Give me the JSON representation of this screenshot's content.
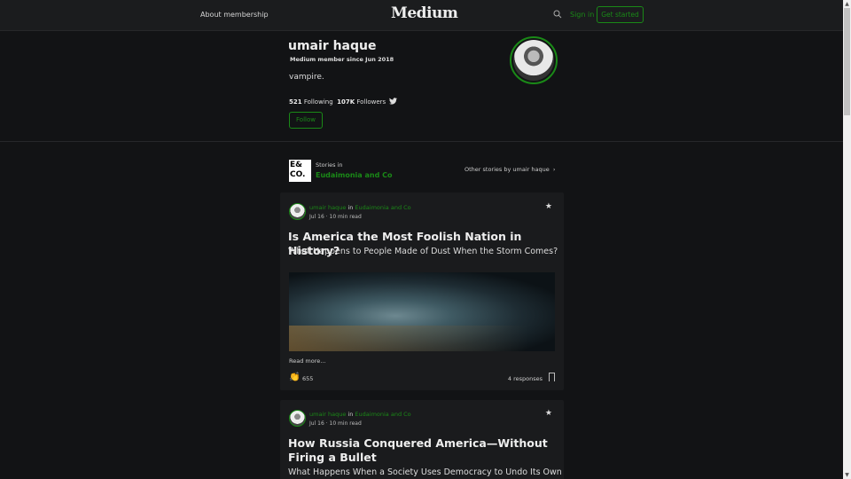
{
  "header": {
    "about": "About membership",
    "logo": "Medium",
    "sign_in": "Sign in",
    "get_started": "Get started"
  },
  "profile": {
    "name": "umair haque",
    "since": "Medium member since Jun 2018",
    "bio": "vampire.",
    "following_count": "521",
    "following_label": "Following",
    "followers_count": "107K",
    "followers_label": "Followers",
    "separator": "·",
    "follow": "Follow"
  },
  "publication": {
    "logo_text": "E& CO.",
    "stories_in": "Stories in",
    "name": "Eudaimonia and Co",
    "other": "Other stories by umair haque"
  },
  "posts": [
    {
      "author": "umair haque",
      "in": "in",
      "pub": "Eudaimonia and Co",
      "date": "Jul 16",
      "read": "10 min read",
      "title": "Is America the Most Foolish Nation in History?",
      "subtitle": "What Happens to People Made of Dust When the Storm Comes?",
      "read_more": "Read more…",
      "claps": "655",
      "responses": "4 responses"
    },
    {
      "author": "umair haque",
      "in": "in",
      "pub": "Eudaimonia and Co",
      "date": "Jul 16",
      "read": "10 min read",
      "title": "How Russia Conquered America—Without Firing a Bullet",
      "subtitle": "What Happens When a Society Uses Democracy to Undo Its Own"
    }
  ]
}
